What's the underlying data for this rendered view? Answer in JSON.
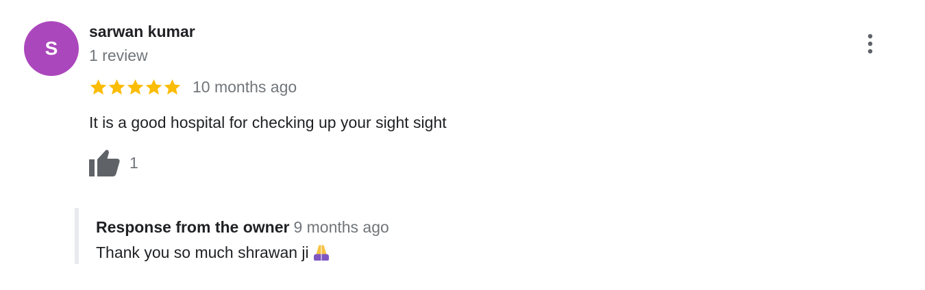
{
  "review": {
    "author": {
      "initial": "S",
      "name": "sarwan kumar",
      "review_count": "1 review",
      "avatar_color": "#ab47bc"
    },
    "rating": 5,
    "rating_max": 5,
    "date": "10 months ago",
    "text": "It is a good hospital for checking up your sight sight",
    "likes": "1",
    "menu_icon": "more-vert-icon",
    "like_icon": "thumb-up-icon"
  },
  "owner_response": {
    "title": "Response from the owner",
    "date": "9 months ago",
    "text": "Thank you so much shrawan ji",
    "emoji_icon": "folded-hands-icon"
  },
  "colors": {
    "star": "#fbbc04",
    "secondary_text": "#70757a",
    "primary_text": "#202124",
    "icon": "#5f6368",
    "response_border": "#e8eaed",
    "emoji_purple": "#7e57c2",
    "emoji_skin": "#f6c243"
  }
}
